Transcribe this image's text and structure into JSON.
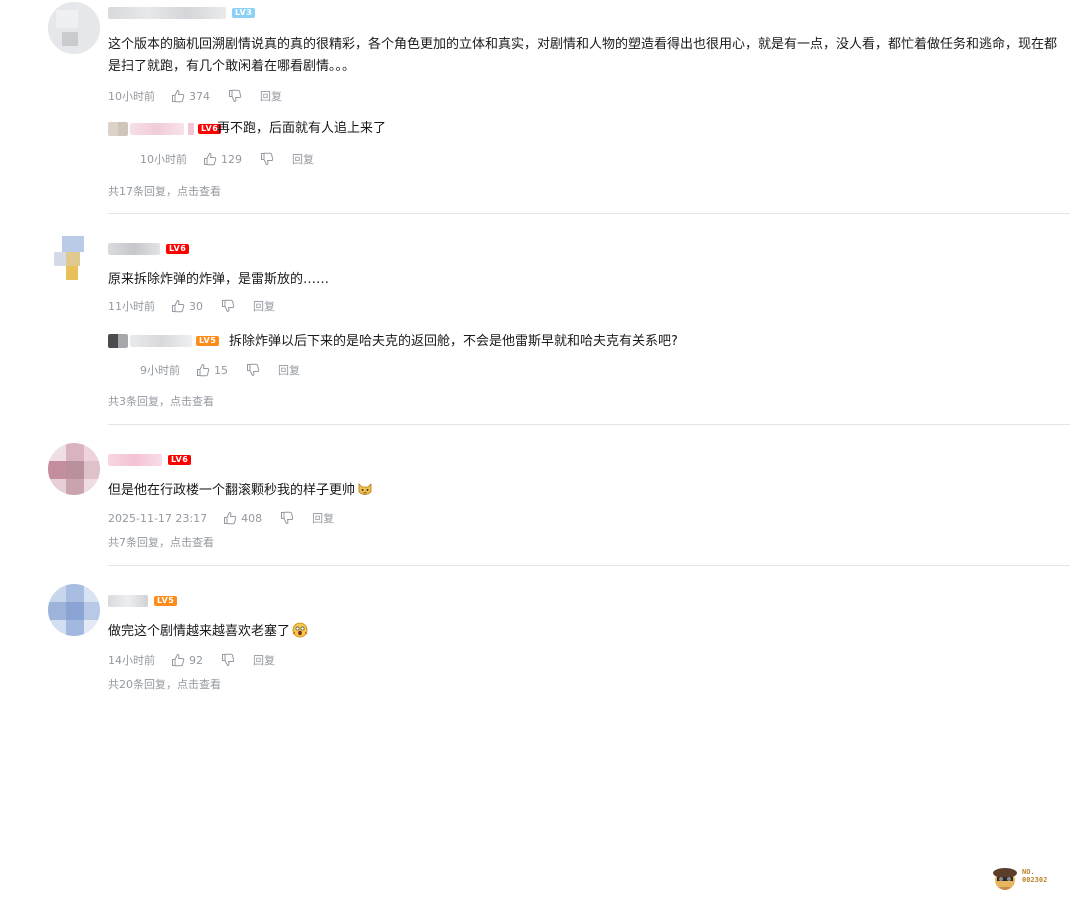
{
  "comments": [
    {
      "level": "LV3",
      "text": "这个版本的脑机回溯剧情说真的真的很精彩，各个角色更加的立体和真实，对剧情和人物的塑造看得出也很用心，就是有一点，没人看，都忙着做任务和逃命，现在都是扫了就跑，有几个敢闲着在哪看剧情。。。",
      "time": "10小时前",
      "likes": "374",
      "reply_label": "回复",
      "sub_reply": {
        "level": "LV6",
        "text": "再不跑，后面就有人追上来了",
        "time": "10小时前",
        "likes": "129",
        "reply_label": "回复"
      },
      "view_more": "共17条回复，点击查看"
    },
    {
      "level": "LV6",
      "text": "原来拆除炸弹的炸弹，是雷斯放的……",
      "time": "11小时前",
      "likes": "30",
      "reply_label": "回复",
      "sub_reply": {
        "level": "LV5",
        "text": "拆除炸弹以后下来的是哈夫克的返回舱，不会是他雷斯早就和哈夫克有关系吧?",
        "time": "9小时前",
        "likes": "15",
        "reply_label": "回复"
      },
      "view_more": "共3条回复，点击查看"
    },
    {
      "level": "LV6",
      "text": "但是他在行政楼一个翻滚颗秒我的样子更帅",
      "time": "2025-11-17 23:17",
      "likes": "408",
      "reply_label": "回复",
      "view_more": "共7条回复，点击查看",
      "badge_no": "NO.",
      "badge_num": "002302"
    },
    {
      "level": "LV5",
      "text": "做完这个剧情越来越喜欢老塞了",
      "time": "14小时前",
      "likes": "92",
      "reply_label": "回复",
      "view_more": "共20条回复，点击查看"
    }
  ],
  "colors": {
    "lv3": "#8bd1f7",
    "lv5": "#ff8c1a",
    "lv6": "#ff0000",
    "meta": "#9499a0",
    "divider": "#e3e5e7"
  }
}
